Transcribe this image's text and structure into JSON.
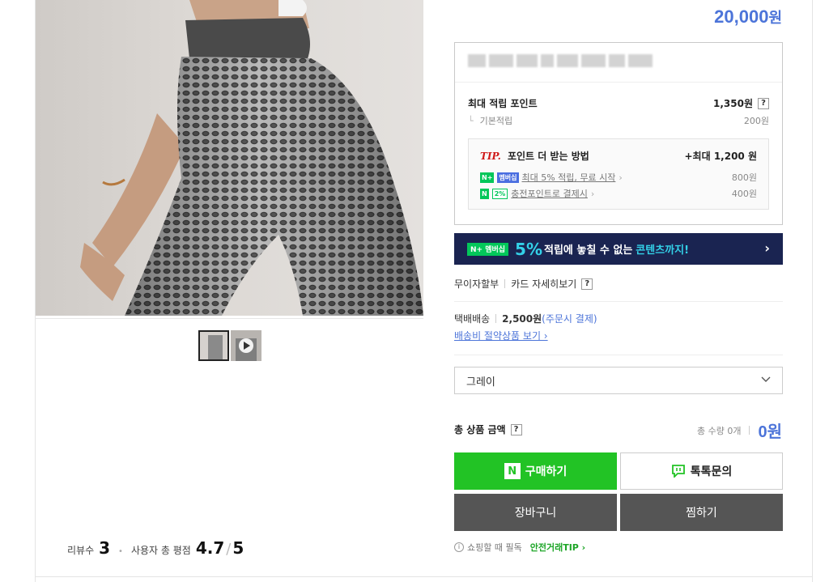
{
  "product": {
    "price": "20,000",
    "price_unit": "원"
  },
  "points": {
    "max_label": "최대 적립 포인트",
    "max_value": "1,350원",
    "help": "?",
    "base_label": "기본적립",
    "base_value": "200원",
    "tip_label": "TIP.",
    "tip_title": "포인트 더 받는 방법",
    "tip_max": "+최대 1,200 원",
    "items": [
      {
        "badges": [
          "N+",
          "멤버십"
        ],
        "text": "최대 5% 적립, 무료 시작",
        "value": "800원"
      },
      {
        "badges": [
          "N",
          "2%"
        ],
        "text": "충전포인트로 결제시",
        "value": "400원"
      }
    ]
  },
  "banner": {
    "badge": "N+ 멤버십",
    "pct": "5%",
    "text_a": "적립에 놓칠 수 없는",
    "text_b": "콘텐츠까지!",
    "chevron": "›"
  },
  "payment": {
    "installment": "무이자할부",
    "card_detail": "카드 자세히보기",
    "help": "?"
  },
  "shipping": {
    "method": "택배배송",
    "fee": "2,500원",
    "note": "(주문시 결제)",
    "save_link": "배송비 절약상품 보기 ›"
  },
  "option": {
    "selected": "그레이"
  },
  "total": {
    "label": "총 상품 금액",
    "help": "?",
    "qty": "총 수량 0개",
    "amount": "0원"
  },
  "buttons": {
    "buy": "구매하기",
    "talk": "톡톡문의",
    "cart": "장바구니",
    "wish": "찜하기",
    "n_logo": "N"
  },
  "safe": {
    "info": "i",
    "text": "쇼핑할 때 필독",
    "link": "안전거래TIP ›"
  },
  "reviews": {
    "count_label": "리뷰수",
    "count": "3",
    "rating_label": "사용자 총 평점",
    "rating": "4.7",
    "rating_max": "5"
  },
  "colors": {
    "accent_blue": "#4c74d9",
    "naver_green": "#22c325",
    "banner_navy": "#1a2451"
  },
  "icons": {
    "play": "play-icon",
    "chevron_down": "chevron-down-icon",
    "talk": "speech-bubble-icon"
  }
}
